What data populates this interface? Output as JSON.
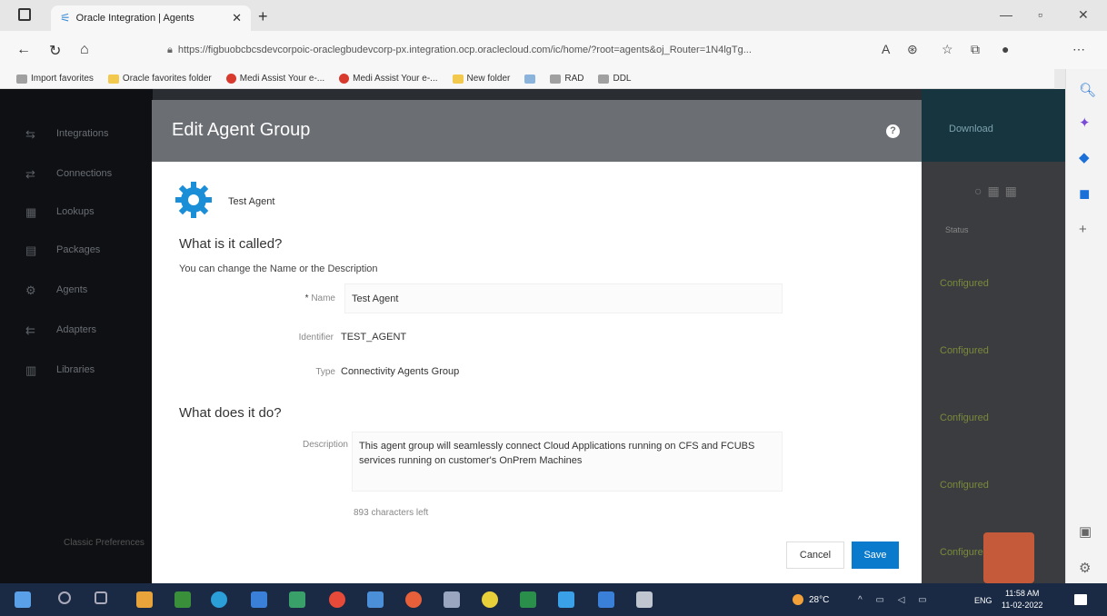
{
  "browser": {
    "tab_title": "Oracle Integration | Agents",
    "url": "https://figbuobcbcsdevcorpoic-oraclegbudevcorp-px.integration.ocp.oraclecloud.com/ic/home/?root=agents&oj_Router=1N4lgTg...",
    "favorites": [
      {
        "label": "Import favorites",
        "kind": "grey"
      },
      {
        "label": "Oracle favorites folder",
        "kind": "folder"
      },
      {
        "label": "Medi Assist Your e-...",
        "kind": "red"
      },
      {
        "label": "Medi Assist Your e-...",
        "kind": "red"
      },
      {
        "label": "New folder",
        "kind": "folder"
      },
      {
        "label": "",
        "kind": "blue"
      },
      {
        "label": "RAD",
        "kind": "grey"
      },
      {
        "label": "DDL",
        "kind": "grey"
      }
    ]
  },
  "background_nav": {
    "items": [
      "Integrations",
      "Connections",
      "Lookups",
      "Packages",
      "Agents",
      "Adapters",
      "Libraries"
    ],
    "footer": "Classic Preferences"
  },
  "background_right": {
    "header_button": "Download",
    "status_header": "Status",
    "statuses": [
      "Configured",
      "Configured",
      "Configured",
      "Configured",
      "Configured"
    ]
  },
  "modal": {
    "title": "Edit Agent Group",
    "help_label": "?",
    "agent_name": "Test Agent",
    "section_called": "What is it called?",
    "hint": "You can change the Name or the Description",
    "name_label": "Name",
    "name_value": "Test Agent",
    "identifier_label": "Identifier",
    "identifier_value": "TEST_AGENT",
    "type_label": "Type",
    "type_value": "Connectivity Agents Group",
    "section_does": "What does it do?",
    "description_label": "Description",
    "description_value": "This agent group will seamlessly connect Cloud Applications running on CFS and FCUBS services running on customer's OnPrem Machines",
    "chars_left": "893 characters left",
    "cancel_label": "Cancel",
    "save_label": "Save"
  },
  "taskbar": {
    "temperature": "28°C",
    "language": "ENG",
    "time": "11:58 AM",
    "date": "11-02-2022"
  },
  "colors": {
    "modal_header": "#6b6f74",
    "primary_button": "#0a7acc",
    "gear_icon": "#1a8fd8"
  }
}
